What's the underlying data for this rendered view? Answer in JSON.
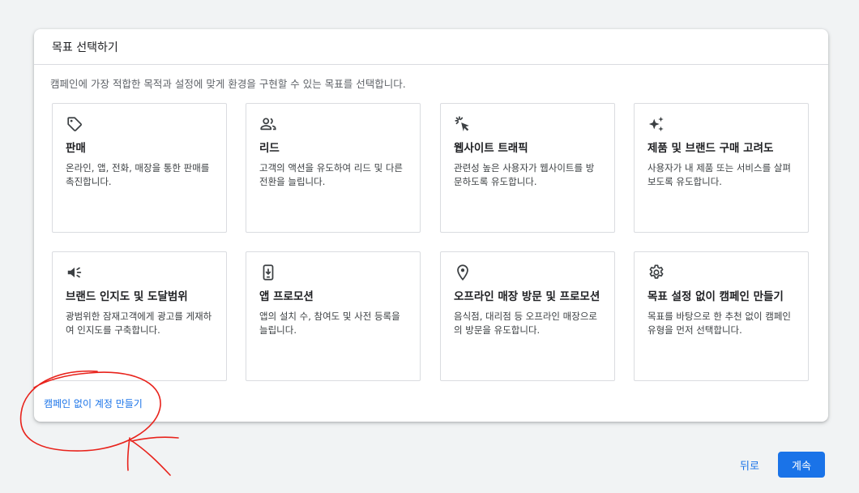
{
  "dialog": {
    "title": "목표 선택하기",
    "description": "캠페인에 가장 적합한 목적과 설정에 맞게 환경을 구현할 수 있는 목표를 선택합니다."
  },
  "goals": [
    {
      "icon": "tag-icon",
      "title": "판매",
      "description": "온라인, 앱, 전화, 매장을 통한 판매를 촉진합니다."
    },
    {
      "icon": "people-icon",
      "title": "리드",
      "description": "고객의 액션을 유도하여 리드 및 다른 전환을 늘립니다."
    },
    {
      "icon": "cursor-click-icon",
      "title": "웹사이트 트래픽",
      "description": "관련성 높은 사용자가 웹사이트를 방문하도록 유도합니다."
    },
    {
      "icon": "sparkle-icon",
      "title": "제품 및 브랜드 구매 고려도",
      "description": "사용자가 내 제품 또는 서비스를 살펴보도록 유도합니다."
    },
    {
      "icon": "speaker-icon",
      "title": "브랜드 인지도 및 도달범위",
      "description": "광범위한 잠재고객에게 광고를 게재하여 인지도를 구축합니다."
    },
    {
      "icon": "mobile-download-icon",
      "title": "앱 프로모션",
      "description": "앱의 설치 수, 참여도 및 사전 등록을 늘립니다."
    },
    {
      "icon": "location-pin-icon",
      "title": "오프라인 매장 방문 및 프로모션",
      "description": "음식점, 대리점 등 오프라인 매장으로의 방문을 유도합니다."
    },
    {
      "icon": "gear-icon",
      "title": "목표 설정 없이 캠페인 만들기",
      "description": "목표를 바탕으로 한 추천 없이 캠페인 유형을 먼저 선택합니다."
    }
  ],
  "create_account_link": "캠페인 없이 계정 만들기",
  "footer": {
    "back_label": "뒤로",
    "continue_label": "계속"
  },
  "colors": {
    "accent": "#1a73e8",
    "annotation": "#e8231c"
  }
}
